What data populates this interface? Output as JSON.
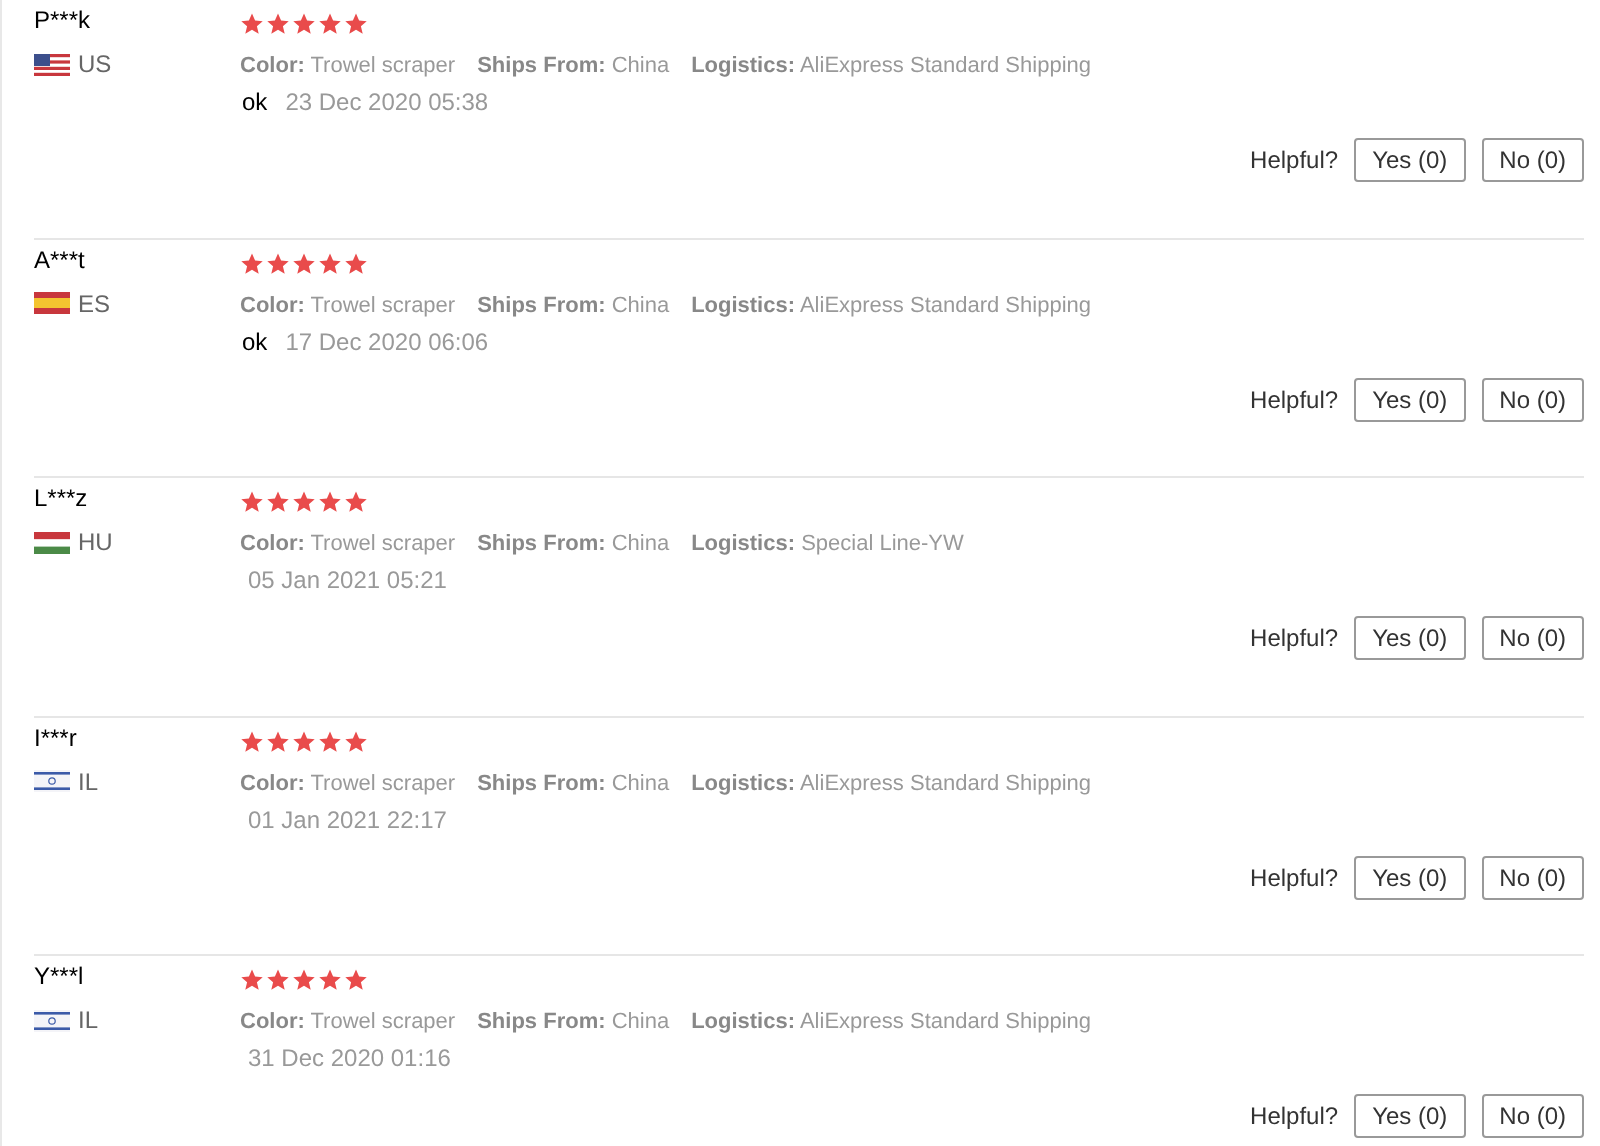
{
  "reviews": [
    {
      "name": "P***k",
      "kind": "us",
      "country": "US",
      "stars": 5,
      "details": [
        {
          "label": "Color:",
          "value": "Trowel scraper"
        },
        {
          "label": "Ships From:",
          "value": "China"
        },
        {
          "label": "Logistics:",
          "value": "AliExpress Standard Shipping"
        }
      ],
      "comment": "ok",
      "date": "23 Dec 2020 05:38",
      "helpful_label": "Helpful?",
      "yes": "Yes (0)",
      "no": "No (0)"
    },
    {
      "name": "A***t",
      "kind": "es",
      "country": "ES",
      "stars": 5,
      "details": [
        {
          "label": "Color:",
          "value": "Trowel scraper"
        },
        {
          "label": "Ships From:",
          "value": "China"
        },
        {
          "label": "Logistics:",
          "value": "AliExpress Standard Shipping"
        }
      ],
      "comment": "ok",
      "date": "17 Dec 2020 06:06",
      "helpful_label": "Helpful?",
      "yes": "Yes (0)",
      "no": "No (0)"
    },
    {
      "name": "L***z",
      "kind": "hu",
      "country": "HU",
      "stars": 5,
      "details": [
        {
          "label": "Color:",
          "value": "Trowel scraper"
        },
        {
          "label": "Ships From:",
          "value": "China"
        },
        {
          "label": "Logistics:",
          "value": "Special Line-YW"
        }
      ],
      "date": "05 Jan 2021 05:21",
      "helpful_label": "Helpful?",
      "yes": "Yes (0)",
      "no": "No (0)"
    },
    {
      "name": "I***r",
      "kind": "il",
      "country": "IL",
      "stars": 5,
      "details": [
        {
          "label": "Color:",
          "value": "Trowel scraper"
        },
        {
          "label": "Ships From:",
          "value": "China"
        },
        {
          "label": "Logistics:",
          "value": "AliExpress Standard Shipping"
        }
      ],
      "date": "01 Jan 2021 22:17",
      "helpful_label": "Helpful?",
      "yes": "Yes (0)",
      "no": "No (0)"
    },
    {
      "name": "Y***l",
      "kind": "il",
      "country": "IL",
      "stars": 5,
      "details": [
        {
          "label": "Color:",
          "value": "Trowel scraper"
        },
        {
          "label": "Ships From:",
          "value": "China"
        },
        {
          "label": "Logistics:",
          "value": "AliExpress Standard Shipping"
        }
      ],
      "date": "31 Dec 2020 01:16",
      "helpful_label": "Helpful?",
      "yes": "Yes (0)",
      "no": "No (0)"
    }
  ]
}
